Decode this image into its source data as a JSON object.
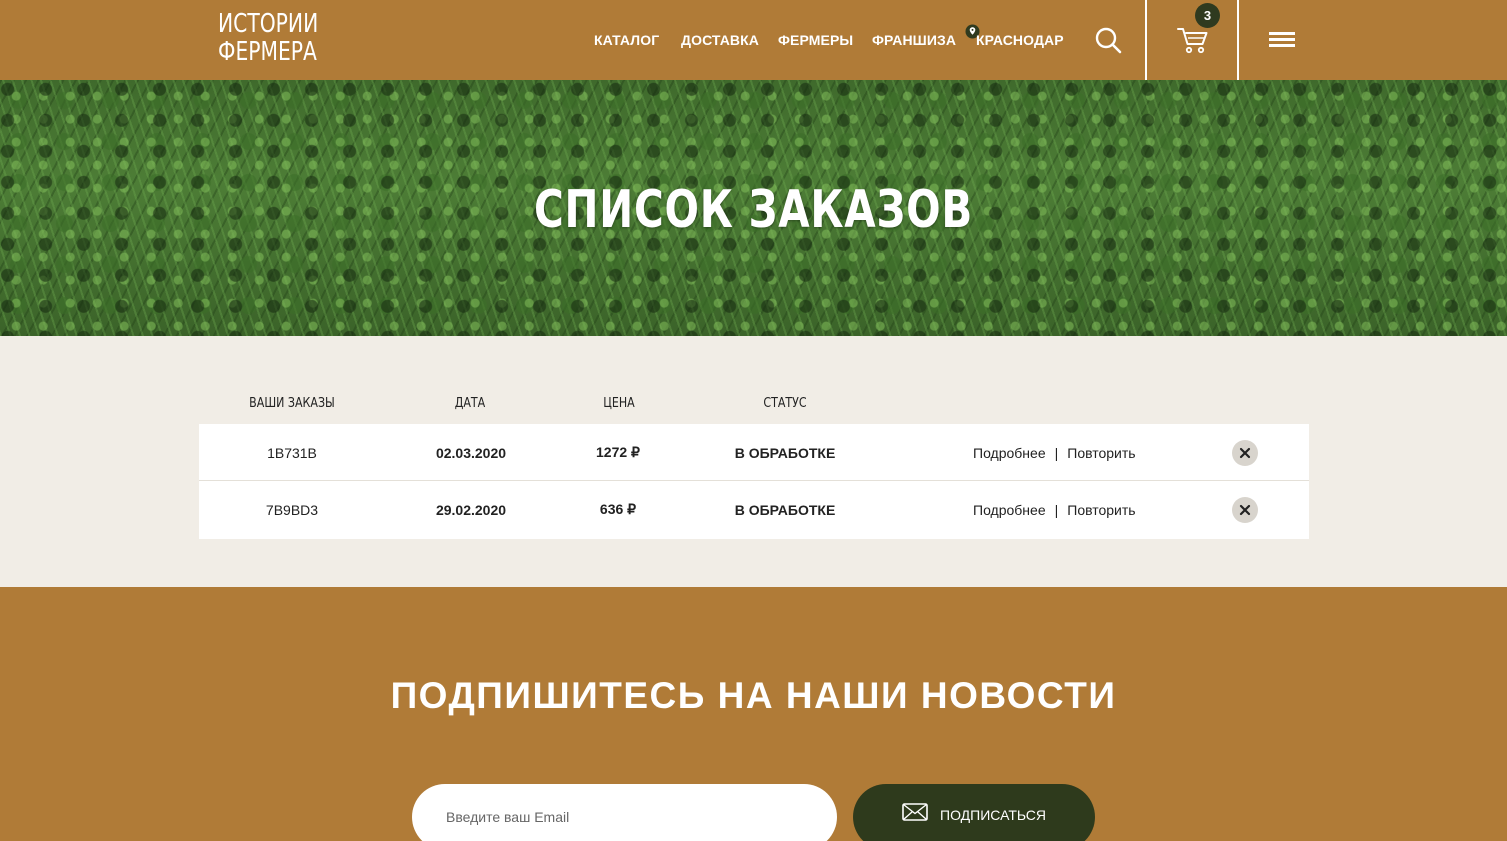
{
  "header": {
    "logo_line1": "ИСТОРИИ",
    "logo_line2": "ФЕРМЕРА",
    "nav": [
      "КАТАЛОГ",
      "ДОСТАВКА",
      "ФЕРМЕРЫ",
      "ФРАНШИЗА"
    ],
    "city": "КРАСНОДАР",
    "cart_count": "3",
    "icons": {
      "search": "search-icon",
      "cart": "cart-icon",
      "menu": "menu-icon",
      "location": "location-pin-icon"
    }
  },
  "hero": {
    "title": "СПИСОК ЗАКАЗОВ"
  },
  "orders": {
    "columns": [
      "ВАШИ ЗАКАЗЫ",
      "ДАТА",
      "ЦЕНА",
      "СТАТУС"
    ],
    "rows": [
      {
        "number": "1B731B",
        "date": "02.03.2020",
        "price": "1272 ₽",
        "status": "В ОБРАБОТКЕ",
        "details": "Подробнее",
        "separator": "|",
        "repeat": "Повторить"
      },
      {
        "number": "7B9BD3",
        "date": "29.02.2020",
        "price": "636 ₽",
        "status": "В ОБРАБОТКЕ",
        "details": "Подробнее",
        "separator": "|",
        "repeat": "Повторить"
      }
    ]
  },
  "subscribe": {
    "title": "ПОДПИШИТЕСЬ НА НАШИ НОВОСТИ",
    "email_placeholder": "Введите ваш Email",
    "button_label": "ПОДПИСАТЬСЯ"
  },
  "colors": {
    "brand_brown": "#b07b37",
    "dark_green": "#2e3a1c",
    "page_bg": "#f1ede6"
  }
}
